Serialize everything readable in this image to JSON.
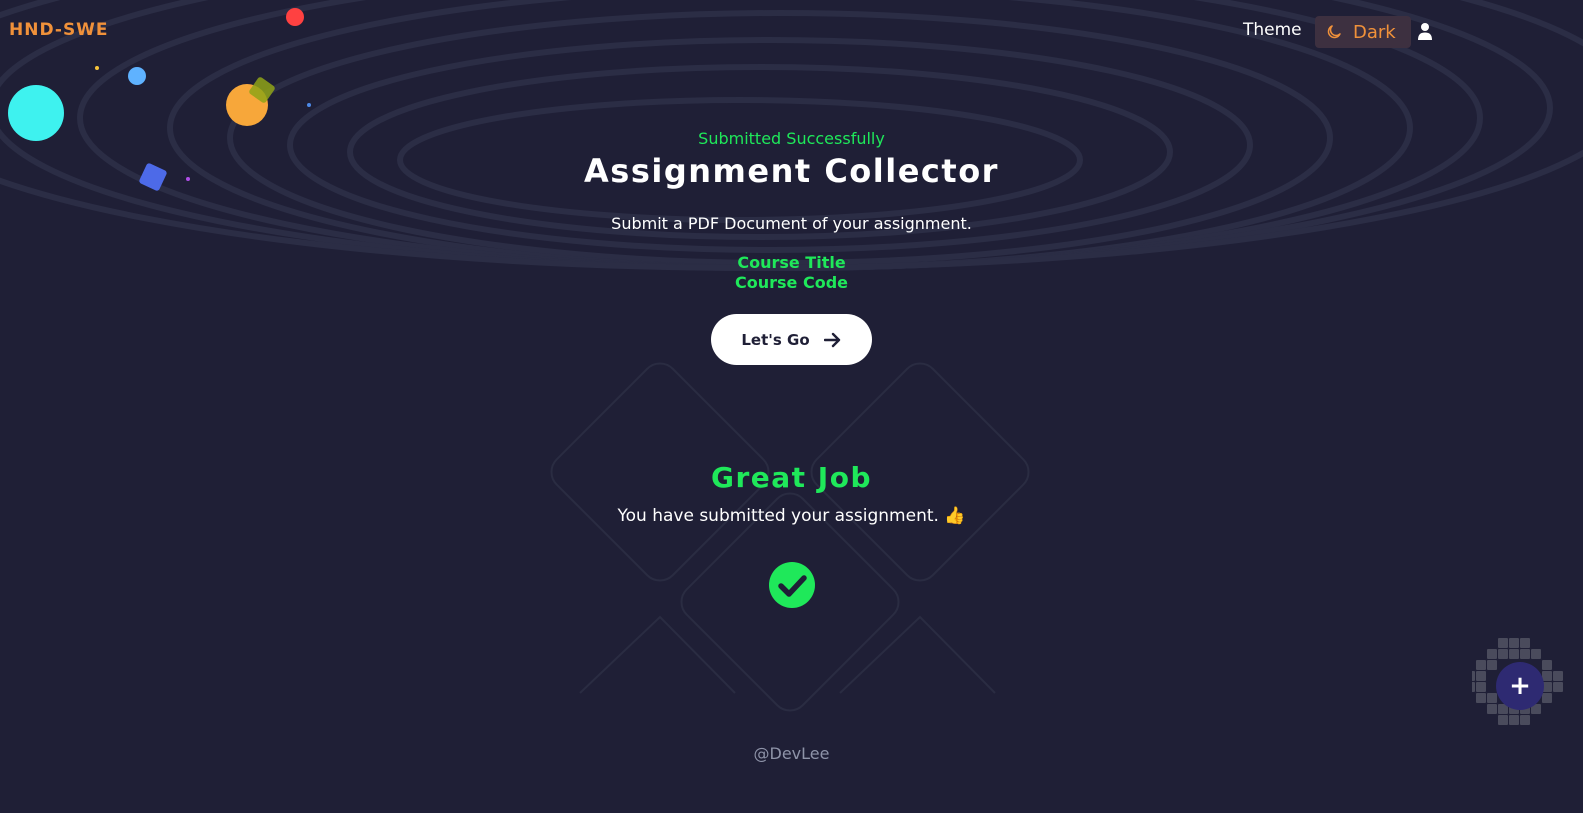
{
  "brand": {
    "name": "HND-SWE",
    "color": "#f0913a"
  },
  "header": {
    "theme_label": "Theme",
    "theme_toggle": {
      "icon": "moon-icon",
      "label": "Dark"
    },
    "user_icon": "user-icon"
  },
  "hero": {
    "status": "Submitted Successfully",
    "title": "Assignment Collector",
    "subtitle": "Submit a PDF Document of your assignment.",
    "course_title": "Course Title",
    "course_code": "Course Code",
    "cta_label": "Let's Go",
    "cta_icon": "arrow-right-icon"
  },
  "result": {
    "heading": "Great Job",
    "message": "You have submitted your assignment. 👍",
    "icon": "check-circle-icon"
  },
  "footer": {
    "credit": "@DevLee"
  },
  "fab": {
    "label": "+",
    "icon": "plus-icon"
  },
  "colors": {
    "background": "#1f1f36",
    "accent_green": "#1fe85a",
    "accent_orange": "#f0913a",
    "fab": "#2e2a72"
  }
}
